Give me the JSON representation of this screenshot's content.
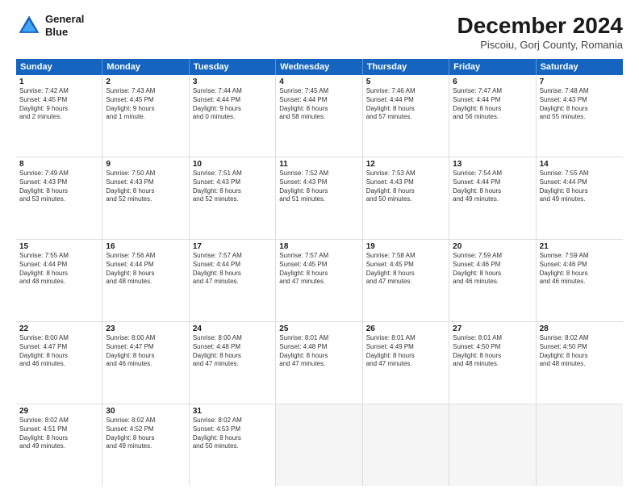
{
  "header": {
    "logo_line1": "General",
    "logo_line2": "Blue",
    "title": "December 2024",
    "subtitle": "Piscoiu, Gorj County, Romania"
  },
  "days_of_week": [
    "Sunday",
    "Monday",
    "Tuesday",
    "Wednesday",
    "Thursday",
    "Friday",
    "Saturday"
  ],
  "weeks": [
    [
      {
        "day": "1",
        "lines": [
          "Sunrise: 7:42 AM",
          "Sunset: 4:45 PM",
          "Daylight: 9 hours",
          "and 2 minutes."
        ]
      },
      {
        "day": "2",
        "lines": [
          "Sunrise: 7:43 AM",
          "Sunset: 4:45 PM",
          "Daylight: 9 hours",
          "and 1 minute."
        ]
      },
      {
        "day": "3",
        "lines": [
          "Sunrise: 7:44 AM",
          "Sunset: 4:44 PM",
          "Daylight: 9 hours",
          "and 0 minutes."
        ]
      },
      {
        "day": "4",
        "lines": [
          "Sunrise: 7:45 AM",
          "Sunset: 4:44 PM",
          "Daylight: 8 hours",
          "and 58 minutes."
        ]
      },
      {
        "day": "5",
        "lines": [
          "Sunrise: 7:46 AM",
          "Sunset: 4:44 PM",
          "Daylight: 8 hours",
          "and 57 minutes."
        ]
      },
      {
        "day": "6",
        "lines": [
          "Sunrise: 7:47 AM",
          "Sunset: 4:44 PM",
          "Daylight: 8 hours",
          "and 56 minutes."
        ]
      },
      {
        "day": "7",
        "lines": [
          "Sunrise: 7:48 AM",
          "Sunset: 4:43 PM",
          "Daylight: 8 hours",
          "and 55 minutes."
        ]
      }
    ],
    [
      {
        "day": "8",
        "lines": [
          "Sunrise: 7:49 AM",
          "Sunset: 4:43 PM",
          "Daylight: 8 hours",
          "and 53 minutes."
        ]
      },
      {
        "day": "9",
        "lines": [
          "Sunrise: 7:50 AM",
          "Sunset: 4:43 PM",
          "Daylight: 8 hours",
          "and 52 minutes."
        ]
      },
      {
        "day": "10",
        "lines": [
          "Sunrise: 7:51 AM",
          "Sunset: 4:43 PM",
          "Daylight: 8 hours",
          "and 52 minutes."
        ]
      },
      {
        "day": "11",
        "lines": [
          "Sunrise: 7:52 AM",
          "Sunset: 4:43 PM",
          "Daylight: 8 hours",
          "and 51 minutes."
        ]
      },
      {
        "day": "12",
        "lines": [
          "Sunrise: 7:53 AM",
          "Sunset: 4:43 PM",
          "Daylight: 8 hours",
          "and 50 minutes."
        ]
      },
      {
        "day": "13",
        "lines": [
          "Sunrise: 7:54 AM",
          "Sunset: 4:44 PM",
          "Daylight: 8 hours",
          "and 49 minutes."
        ]
      },
      {
        "day": "14",
        "lines": [
          "Sunrise: 7:55 AM",
          "Sunset: 4:44 PM",
          "Daylight: 8 hours",
          "and 49 minutes."
        ]
      }
    ],
    [
      {
        "day": "15",
        "lines": [
          "Sunrise: 7:55 AM",
          "Sunset: 4:44 PM",
          "Daylight: 8 hours",
          "and 48 minutes."
        ]
      },
      {
        "day": "16",
        "lines": [
          "Sunrise: 7:56 AM",
          "Sunset: 4:44 PM",
          "Daylight: 8 hours",
          "and 48 minutes."
        ]
      },
      {
        "day": "17",
        "lines": [
          "Sunrise: 7:57 AM",
          "Sunset: 4:44 PM",
          "Daylight: 8 hours",
          "and 47 minutes."
        ]
      },
      {
        "day": "18",
        "lines": [
          "Sunrise: 7:57 AM",
          "Sunset: 4:45 PM",
          "Daylight: 8 hours",
          "and 47 minutes."
        ]
      },
      {
        "day": "19",
        "lines": [
          "Sunrise: 7:58 AM",
          "Sunset: 4:45 PM",
          "Daylight: 8 hours",
          "and 47 minutes."
        ]
      },
      {
        "day": "20",
        "lines": [
          "Sunrise: 7:59 AM",
          "Sunset: 4:46 PM",
          "Daylight: 8 hours",
          "and 46 minutes."
        ]
      },
      {
        "day": "21",
        "lines": [
          "Sunrise: 7:59 AM",
          "Sunset: 4:46 PM",
          "Daylight: 8 hours",
          "and 46 minutes."
        ]
      }
    ],
    [
      {
        "day": "22",
        "lines": [
          "Sunrise: 8:00 AM",
          "Sunset: 4:47 PM",
          "Daylight: 8 hours",
          "and 46 minutes."
        ]
      },
      {
        "day": "23",
        "lines": [
          "Sunrise: 8:00 AM",
          "Sunset: 4:47 PM",
          "Daylight: 8 hours",
          "and 46 minutes."
        ]
      },
      {
        "day": "24",
        "lines": [
          "Sunrise: 8:00 AM",
          "Sunset: 4:48 PM",
          "Daylight: 8 hours",
          "and 47 minutes."
        ]
      },
      {
        "day": "25",
        "lines": [
          "Sunrise: 8:01 AM",
          "Sunset: 4:48 PM",
          "Daylight: 8 hours",
          "and 47 minutes."
        ]
      },
      {
        "day": "26",
        "lines": [
          "Sunrise: 8:01 AM",
          "Sunset: 4:49 PM",
          "Daylight: 8 hours",
          "and 47 minutes."
        ]
      },
      {
        "day": "27",
        "lines": [
          "Sunrise: 8:01 AM",
          "Sunset: 4:50 PM",
          "Daylight: 8 hours",
          "and 48 minutes."
        ]
      },
      {
        "day": "28",
        "lines": [
          "Sunrise: 8:02 AM",
          "Sunset: 4:50 PM",
          "Daylight: 8 hours",
          "and 48 minutes."
        ]
      }
    ],
    [
      {
        "day": "29",
        "lines": [
          "Sunrise: 8:02 AM",
          "Sunset: 4:51 PM",
          "Daylight: 8 hours",
          "and 49 minutes."
        ]
      },
      {
        "day": "30",
        "lines": [
          "Sunrise: 8:02 AM",
          "Sunset: 4:52 PM",
          "Daylight: 8 hours",
          "and 49 minutes."
        ]
      },
      {
        "day": "31",
        "lines": [
          "Sunrise: 8:02 AM",
          "Sunset: 4:53 PM",
          "Daylight: 8 hours",
          "and 50 minutes."
        ]
      },
      null,
      null,
      null,
      null
    ]
  ]
}
